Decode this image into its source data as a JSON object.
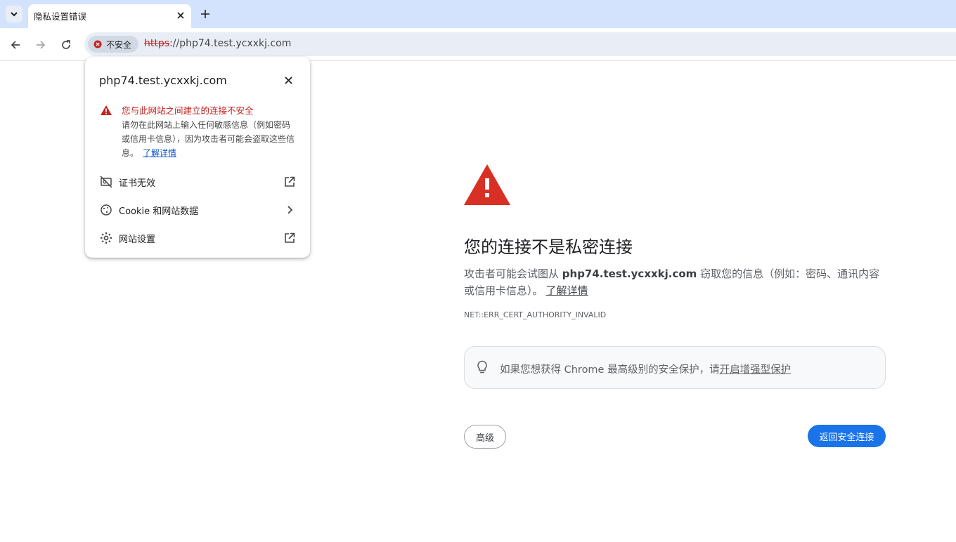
{
  "browser": {
    "tab": {
      "title": "隐私设置错误"
    },
    "omnibox": {
      "security_chip": "不安全",
      "url_scheme": "https",
      "url_rest": "://php74.test.ycxxkj.com"
    },
    "icons": {
      "tab_search": "chevron-down-icon",
      "tab_close": "close-icon",
      "new_tab": "plus-icon",
      "back": "arrow-left-icon",
      "forward": "arrow-right-icon",
      "reload": "reload-icon",
      "security": "error-circle-icon"
    }
  },
  "site_info_popup": {
    "domain": "php74.test.ycxxkj.com",
    "warning_title": "您与此网站之间建立的连接不安全",
    "warning_body": "请勿在此网站上输入任何敏感信息（例如密码或信用卡信息），因为攻击者可能会盗取这些信息。",
    "learn_more": "了解详情",
    "rows": [
      {
        "label": "证书无效",
        "icon": "certificate-off-icon",
        "end_icon": "open-external-icon"
      },
      {
        "label": "Cookie 和网站数据",
        "icon": "cookie-icon",
        "end_icon": "chevron-right-icon"
      },
      {
        "label": "网站设置",
        "icon": "gear-icon",
        "end_icon": "open-external-icon"
      }
    ]
  },
  "interstitial": {
    "heading": "您的连接不是私密连接",
    "desc_before": "攻击者可能会试图从 ",
    "desc_domain": "php74.test.ycxxkj.com",
    "desc_after": " 窃取您的信息（例如：密码、通讯内容或信用卡信息）。",
    "learn_more": "了解详情",
    "error_code": "NET::ERR_CERT_AUTHORITY_INVALID",
    "enhanced_text": "如果您想获得 Chrome 最高级别的安全保护，请",
    "enhanced_link": "开启增强型保护",
    "advanced_button": "高级",
    "back_button": "返回安全连接"
  },
  "colors": {
    "danger": "#c5221f",
    "warning_triangle": "#d93025",
    "primary_button": "#1a73e8",
    "tabstrip": "#d3e3fd"
  }
}
